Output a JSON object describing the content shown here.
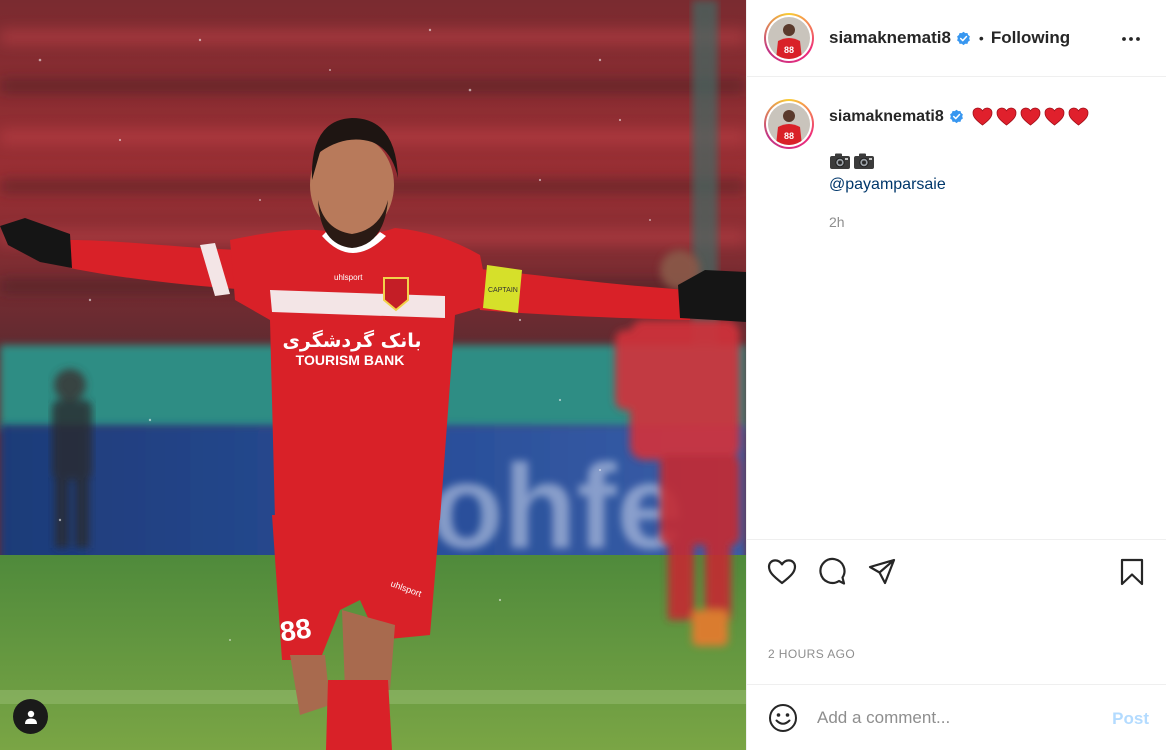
{
  "post": {
    "author": {
      "username": "siamaknemati8",
      "verified": true,
      "follow_status": "Following",
      "jersey_number": "88"
    },
    "separator": "•",
    "caption": {
      "username": "siamaknemati8",
      "heart_count": 5,
      "camera_count": 2,
      "mention": "@payamparsaie",
      "relative_time": "2h"
    },
    "timestamp": "2 HOURS AGO",
    "photo": {
      "jersey_sponsor_fa": "بانک گردشگری",
      "jersey_sponsor_en": "TOURISM BANK",
      "jersey_maker": "uhlsport",
      "shorts_number": "88",
      "ad_board_text": "ohfe",
      "captain_band": "CAPTAIN"
    },
    "comment": {
      "placeholder": "Add a comment...",
      "post_label": "Post"
    }
  },
  "colors": {
    "jersey_red": "#d92128",
    "verified_blue": "#3897f0",
    "mention_blue": "#00376b",
    "muted_text": "#8e8e8e",
    "post_disabled": "#b3dbff"
  },
  "icons": {
    "header_more": "more-horizontal-icon",
    "like": "heart-icon",
    "comment": "comment-icon",
    "share": "paper-plane-icon",
    "save": "bookmark-icon",
    "emoji": "smiley-icon",
    "tags": "person-icon"
  }
}
